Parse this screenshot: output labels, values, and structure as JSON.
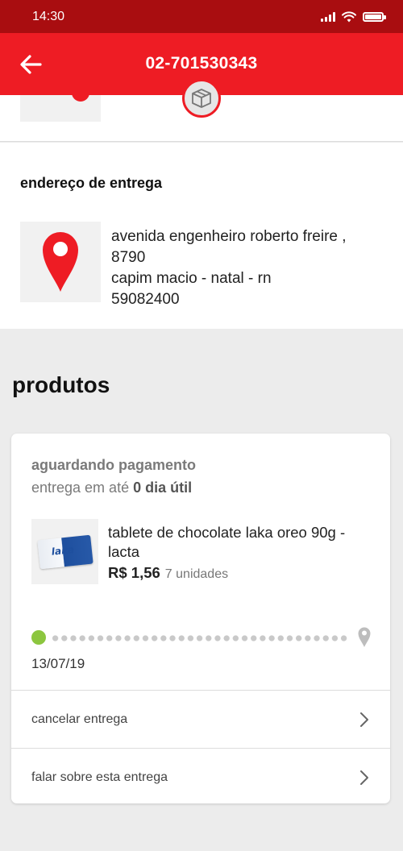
{
  "status_bar": {
    "time": "14:30"
  },
  "header": {
    "title": "02-701530343"
  },
  "address": {
    "heading": "endereço de entrega",
    "street": "avenida engenheiro roberto freire ,",
    "number": "8790",
    "district_city": "capim macio - natal - rn",
    "zip": "59082400"
  },
  "products": {
    "heading": "produtos",
    "card": {
      "status": "aguardando pagamento",
      "delivery_prefix": "entrega em até",
      "delivery_value": "0 dia útil",
      "item": {
        "image_label": "laka",
        "name": "tablete de chocolate laka oreo 90g - lacta",
        "price": "R$ 1,56",
        "quantity": "7 unidades"
      },
      "tracker_date": "13/07/19",
      "actions": {
        "cancel": "cancelar entrega",
        "talk": "falar sobre esta entrega"
      }
    }
  },
  "colors": {
    "brand_red": "#ee1c24",
    "status_bar_red": "#a90d10",
    "tracker_green": "#8cc63f"
  },
  "icons": {
    "back": "arrow-left-icon",
    "package": "package-icon",
    "location": "map-pin-icon",
    "chevron": "chevron-right-icon"
  }
}
